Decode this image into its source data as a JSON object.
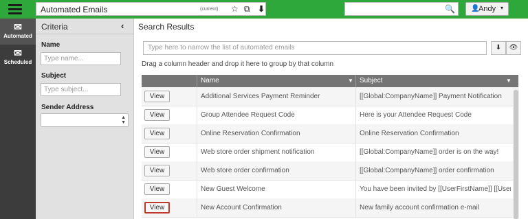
{
  "header": {
    "title": "Automated Emails",
    "current_tag": "(current)",
    "star_icon": "☆",
    "open_icon": "⧉",
    "download_icon": "⬇",
    "search_placeholder": "",
    "search_icon": "🔍",
    "user": {
      "name": "Andy",
      "icon": "👤",
      "caret": "▾"
    }
  },
  "nav": [
    {
      "label": "Automated",
      "icon": "✉"
    },
    {
      "label": "Scheduled",
      "icon": "✉"
    }
  ],
  "criteria": {
    "title": "Criteria",
    "collapse_icon": "‹",
    "name_label": "Name",
    "name_placeholder": "Type name...",
    "subject_label": "Subject",
    "subject_placeholder": "Type subject...",
    "sender_label": "Sender Address",
    "sender_value": ""
  },
  "results": {
    "title": "Search Results",
    "narrow_placeholder": "Type here to narrow the list of automated emails",
    "export_icon": "⬇",
    "hide_icon": "👁",
    "group_hint": "Drag a column header and drop it here to group by that column",
    "columns": [
      "Name",
      "Subject"
    ],
    "filter_icon": "▼",
    "view_label": "View",
    "rows": [
      {
        "name": "Additional Services Payment Reminder",
        "subject": "[[Global:CompanyName]] Payment Notification"
      },
      {
        "name": "Group Attendee Request Code",
        "subject": "Here is your Attendee Request Code"
      },
      {
        "name": "Online Reservation Confirmation",
        "subject": "Online Reservation Confirmation"
      },
      {
        "name": "Web store order shipment notification",
        "subject": "[[Global:CompanyName]] order is on the way!"
      },
      {
        "name": "Web store order confirmation",
        "subject": "[[Global:CompanyName]] order confirmation"
      },
      {
        "name": "New Guest Welcome",
        "subject": "You have been invited by [[UserFirstName]] [[User..."
      },
      {
        "name": "New Account Confirmation",
        "subject": "New family account confirmation e-mail"
      }
    ]
  },
  "colors": {
    "topbar": "#2ea83a",
    "nav": "#3c3c3c",
    "grid_header": "#757575",
    "highlight": "#c0392b"
  }
}
